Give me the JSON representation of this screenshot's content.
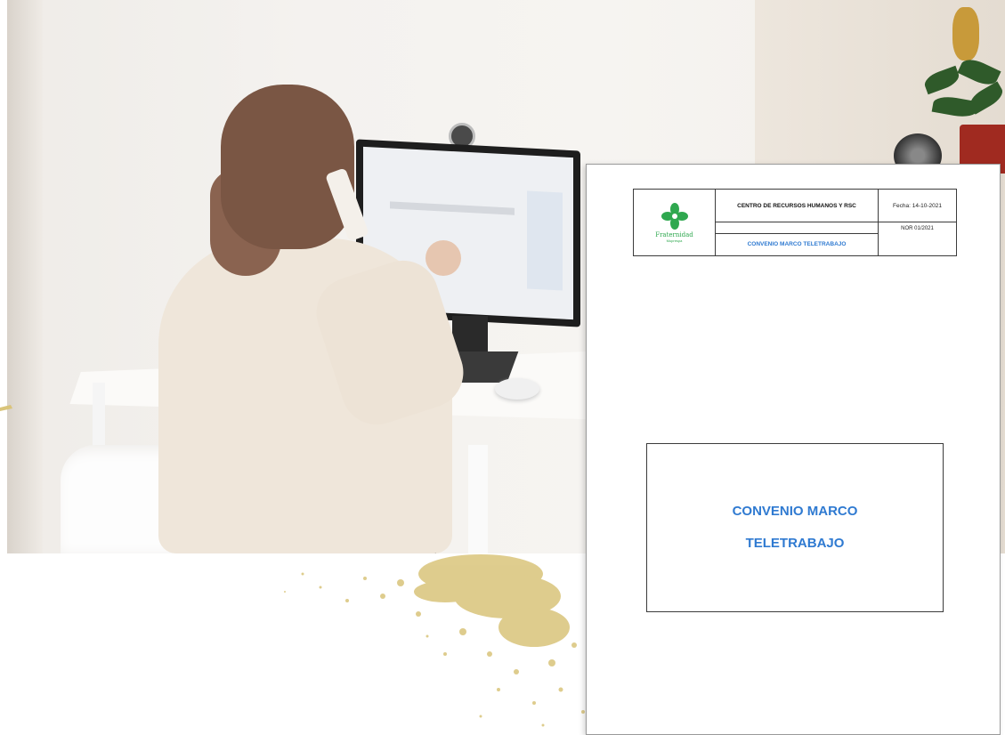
{
  "document": {
    "logo": {
      "name": "Fraternidad",
      "subtitle": "Muprespa"
    },
    "header": {
      "department": "CENTRO DE RECURSOS HUMANOS Y RSC",
      "subject": "CONVENIO MARCO TELETRABAJO",
      "date": "Fecha: 14-10-2021",
      "code": "NOR 01/2021"
    },
    "title": {
      "line1": "CONVENIO MARCO",
      "line2": "TELETRABAJO"
    }
  },
  "colors": {
    "accent_blue": "#2f7ad1",
    "logo_green": "#2fa84f",
    "splatter_gold": "#d9c47a"
  }
}
